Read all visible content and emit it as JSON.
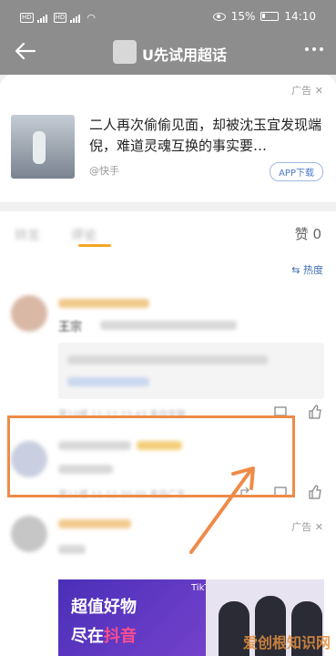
{
  "status_bar": {
    "left_labels": [
      "HD",
      "HD"
    ],
    "battery": "15%",
    "time": "14:10"
  },
  "header": {
    "title": "U先试用超话"
  },
  "ad_card": {
    "tag": "广告",
    "title": "二人再次偷偷见面，却被沈玉宜发现端倪，难道灵魂互换的事实要…",
    "source": "@快手",
    "cta": "APP下载"
  },
  "tabs": {
    "reposts": "转发",
    "comments": "评论",
    "likes": "赞 0"
  },
  "sort": {
    "label": "热度"
  },
  "comment1": {
    "name_prefix": "王宗"
  },
  "comment2": {
    "meta": "第11楼  11-12 00:00  来自广东"
  },
  "ad2": {
    "tag": "广告",
    "line1": "超值好物",
    "line2a": "尽在",
    "line2b": "抖音",
    "brand": "TikTok"
  },
  "watermark": "爱创根知识网",
  "colors": {
    "accent": "#f5a623",
    "highlight": "#ee8b47",
    "link": "#3d6db5"
  }
}
